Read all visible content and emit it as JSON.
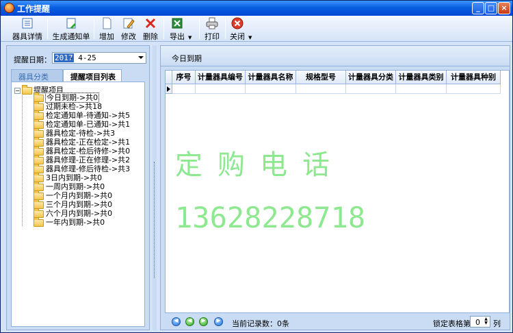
{
  "window": {
    "title": "工作提醒"
  },
  "toolbar": {
    "buttons": [
      {
        "label": "器具详情",
        "icon": "list-details-icon"
      },
      {
        "label": "生成通知单",
        "icon": "generate-notice-icon"
      },
      {
        "label": "增加",
        "icon": "new-document-icon"
      },
      {
        "label": "修改",
        "icon": "edit-pencil-icon"
      },
      {
        "label": "删除",
        "icon": "delete-x-icon"
      },
      {
        "label": "导出",
        "icon": "excel-export-icon"
      },
      {
        "label": "打印",
        "icon": "printer-icon"
      },
      {
        "label": "关闭",
        "icon": "close-red-icon"
      }
    ]
  },
  "left": {
    "date_label": "提醒日期：",
    "date_year": "2017",
    "date_rest": "- 4-25",
    "tabs": [
      "器具分类",
      "提醒项目列表"
    ],
    "tree": {
      "root": "提醒项目",
      "items": [
        "今日到期->共0",
        "过期未检->共18",
        "检定通知单-待通知->共5",
        "检定通知单-已通知->共1",
        "器具检定-待检->共3",
        "器具检定-正在检定->共1",
        "器具检定-检后待修->共0",
        "器具修理-正在修理->共2",
        "器具修理-修后待检->共3",
        "3日内到期->共0",
        "一周内到期->共0",
        "一个月内到期->共0",
        "三个月内到期->共0",
        "六个月内到期->共0",
        "一年内到期->共0"
      ]
    }
  },
  "right": {
    "title": "今日到期",
    "columns": [
      "序号",
      "计量器具编号",
      "计量器具名称",
      "规格型号",
      "计量器具分类",
      "计量器具类别",
      "计量器具种别"
    ],
    "watermark_line1": "定购电话",
    "watermark_line2": "13628228718",
    "record_count": "当前记录数：0条",
    "lock_label": "锁定表格第",
    "lock_value": "0",
    "lock_unit": "列"
  },
  "colors": {
    "titlebar": "#0a5fe0",
    "panel": "#c9dcf3",
    "watermark": "#8de890"
  }
}
